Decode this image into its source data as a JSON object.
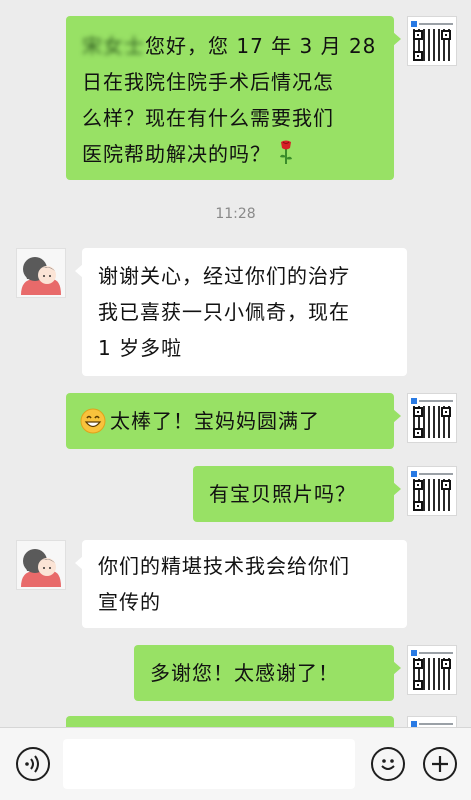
{
  "messages": [
    {
      "side": "right",
      "name": "宋女士",
      "text_line1": "您好，您 17 年 3 月 28",
      "text_line2": "日在我院住院手术后情况怎",
      "text_line3": "么样？现在有什么需要我们",
      "text_line4": "医院帮助解决的吗？",
      "emoji": "rose-emoji"
    },
    {
      "side": "left",
      "text_line1": "谢谢关心，经过你们的治疗",
      "text_line2": "我已喜获一只小佩奇，现在",
      "text_line3": "1 岁多啦"
    },
    {
      "side": "right",
      "text": "太棒了！宝妈妈圆满了",
      "emoji": "grinning-face-emoji"
    },
    {
      "side": "right",
      "text": "有宝贝照片吗？"
    },
    {
      "side": "left",
      "text_line1": "你们的精堪技术我会给你们",
      "text_line2": "宣传的"
    },
    {
      "side": "right",
      "text": "多谢您！太感谢了！"
    }
  ],
  "timestamp": "11:28",
  "input_bar": {
    "voice_icon": "voice-icon",
    "emoji_icon": "emoji-icon",
    "more_icon": "plus-icon",
    "input_placeholder": ""
  },
  "colors": {
    "background": "#ececec",
    "self_bubble": "#98e165",
    "other_bubble": "#ffffff",
    "timestamp_text": "#8a8a8a"
  }
}
